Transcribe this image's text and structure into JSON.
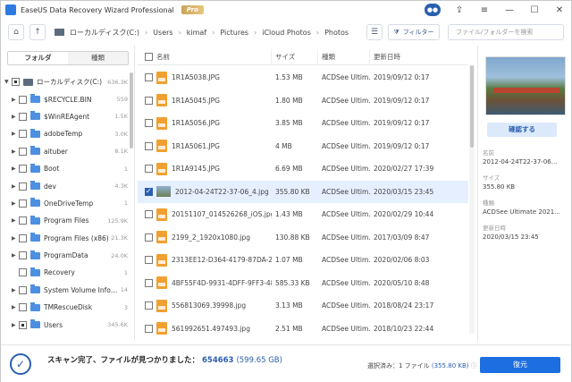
{
  "app": {
    "title": "EaseUS Data Recovery Wizard Professional",
    "badge": "Pro"
  },
  "window_controls": [
    "logo-icon",
    "upload-icon",
    "menu-icon",
    "minimize-icon",
    "maximize-icon",
    "close-icon"
  ],
  "toolbar": {
    "breadcrumb": [
      "ローカルディスク(C:)",
      "Users",
      "kimaf",
      "Pictures",
      "iCloud Photos",
      "Photos"
    ],
    "filter_label": "フィルター",
    "search_placeholder": "ファイル/フォルダーを検索"
  },
  "left_panel": {
    "tabs": [
      "フォルダ",
      "種類"
    ],
    "tree": [
      {
        "label": "ローカルディスク(C:)",
        "count": "636.3K",
        "type": "drive",
        "expanded": true,
        "check": "partial"
      },
      {
        "label": "$RECYCLE.BIN",
        "count": "559",
        "type": "folder",
        "check": "none"
      },
      {
        "label": "$WinREAgent",
        "count": "1.5K",
        "type": "folder",
        "check": "none"
      },
      {
        "label": "adobeTemp",
        "count": "3.0K",
        "type": "folder",
        "check": "none"
      },
      {
        "label": "aituber",
        "count": "8.1K",
        "type": "folder",
        "check": "none"
      },
      {
        "label": "Boot",
        "count": "1",
        "type": "folder",
        "check": "none"
      },
      {
        "label": "dev",
        "count": "4.3K",
        "type": "folder",
        "check": "none"
      },
      {
        "label": "OneDriveTemp",
        "count": "1",
        "type": "folder",
        "check": "none"
      },
      {
        "label": "Program Files",
        "count": "125.9K",
        "type": "folder",
        "check": "none"
      },
      {
        "label": "Program Files (x86)",
        "count": "21.3K",
        "type": "folder",
        "check": "none"
      },
      {
        "label": "ProgramData",
        "count": "24.0K",
        "type": "folder",
        "check": "none"
      },
      {
        "label": "Recovery",
        "count": "1",
        "type": "folder",
        "check": "none"
      },
      {
        "label": "System Volume Inform...",
        "count": "14",
        "type": "folder",
        "check": "none"
      },
      {
        "label": "TMRescueDisk",
        "count": "3",
        "type": "folder",
        "check": "none"
      },
      {
        "label": "Users",
        "count": "345.6K",
        "type": "folder",
        "check": "partial"
      }
    ]
  },
  "file_list": {
    "headers": [
      "名前",
      "サイズ",
      "種類",
      "更新日時"
    ],
    "rows": [
      {
        "name": "1R1A5038.JPG",
        "size": "1.53 MB",
        "type": "ACDSee Ultim...",
        "date": "2019/09/12 0:17",
        "selected": false,
        "icon": "image-file-icon"
      },
      {
        "name": "1R1A5045.JPG",
        "size": "1.80 MB",
        "type": "ACDSee Ultim...",
        "date": "2019/09/12 0:17",
        "selected": false,
        "icon": "image-file-icon"
      },
      {
        "name": "1R1A5056.JPG",
        "size": "3.85 MB",
        "type": "ACDSee Ultim...",
        "date": "2019/09/12 0:17",
        "selected": false,
        "icon": "image-file-icon"
      },
      {
        "name": "1R1A5061.JPG",
        "size": "4 MB",
        "type": "ACDSee Ultim...",
        "date": "2019/09/12 0:17",
        "selected": false,
        "icon": "image-file-icon"
      },
      {
        "name": "1R1A9145.JPG",
        "size": "6.69 MB",
        "type": "ACDSee Ultim...",
        "date": "2020/02/27 17:39",
        "selected": false,
        "icon": "image-file-icon"
      },
      {
        "name": "2012-04-24T22-37-06_4.jpg",
        "size": "355.80 KB",
        "type": "ACDSee Ultim...",
        "date": "2020/03/15 23:45",
        "selected": true,
        "icon": "photo-thumbnail-icon"
      },
      {
        "name": "20151107_014526268_iOS.jpg",
        "size": "1.43 MB",
        "type": "ACDSee Ultim...",
        "date": "2020/02/29 10:44",
        "selected": false,
        "icon": "image-file-icon"
      },
      {
        "name": "2199_2_1920x1080.jpg",
        "size": "130.88 KB",
        "type": "ACDSee Ultim...",
        "date": "2017/03/09 8:47",
        "selected": false,
        "icon": "image-file-icon"
      },
      {
        "name": "2313EE12-D364-4179-87DA-2...",
        "size": "1.07 MB",
        "type": "ACDSee Ultim...",
        "date": "2020/02/06 8:03",
        "selected": false,
        "icon": "image-file-icon"
      },
      {
        "name": "4BF55F4D-9931-4DFF-9FF3-48...",
        "size": "585.33 KB",
        "type": "ACDSee Ultim...",
        "date": "2020/05/10 8:48",
        "selected": false,
        "icon": "image-file-icon"
      },
      {
        "name": "556813069.39998.jpg",
        "size": "3.13 MB",
        "type": "ACDSee Ultim...",
        "date": "2018/08/24 23:17",
        "selected": false,
        "icon": "image-file-icon"
      },
      {
        "name": "561992651.497493.jpg",
        "size": "2.51 MB",
        "type": "ACDSee Ultim...",
        "date": "2018/10/23 22:44",
        "selected": false,
        "icon": "image-file-icon"
      }
    ]
  },
  "preview": {
    "confirm_label": "確認する",
    "name_label": "名前",
    "name_value": "2012-04-24T22-37-06...",
    "size_label": "サイズ",
    "size_value": "355.80 KB",
    "type_label": "種類",
    "type_value": "ACDSee Ultimate 2021...",
    "date_label": "更新日時",
    "date_value": "2020/03/15 23:45"
  },
  "status": {
    "message": "スキャン完了、ファイルが見つかりました：",
    "count": "654663",
    "size": "(599.65 GB)",
    "selected_prefix": "選択済み：1 ファイル",
    "selected_size": "(355.80 KB)",
    "recover_label": "復元"
  },
  "colors": {
    "accent": "#1d6ee0",
    "brand_dark": "#2a5fae",
    "file_icon": "#f0a030",
    "folder": "#4d8fe0",
    "selected_row": "#e6efff"
  }
}
